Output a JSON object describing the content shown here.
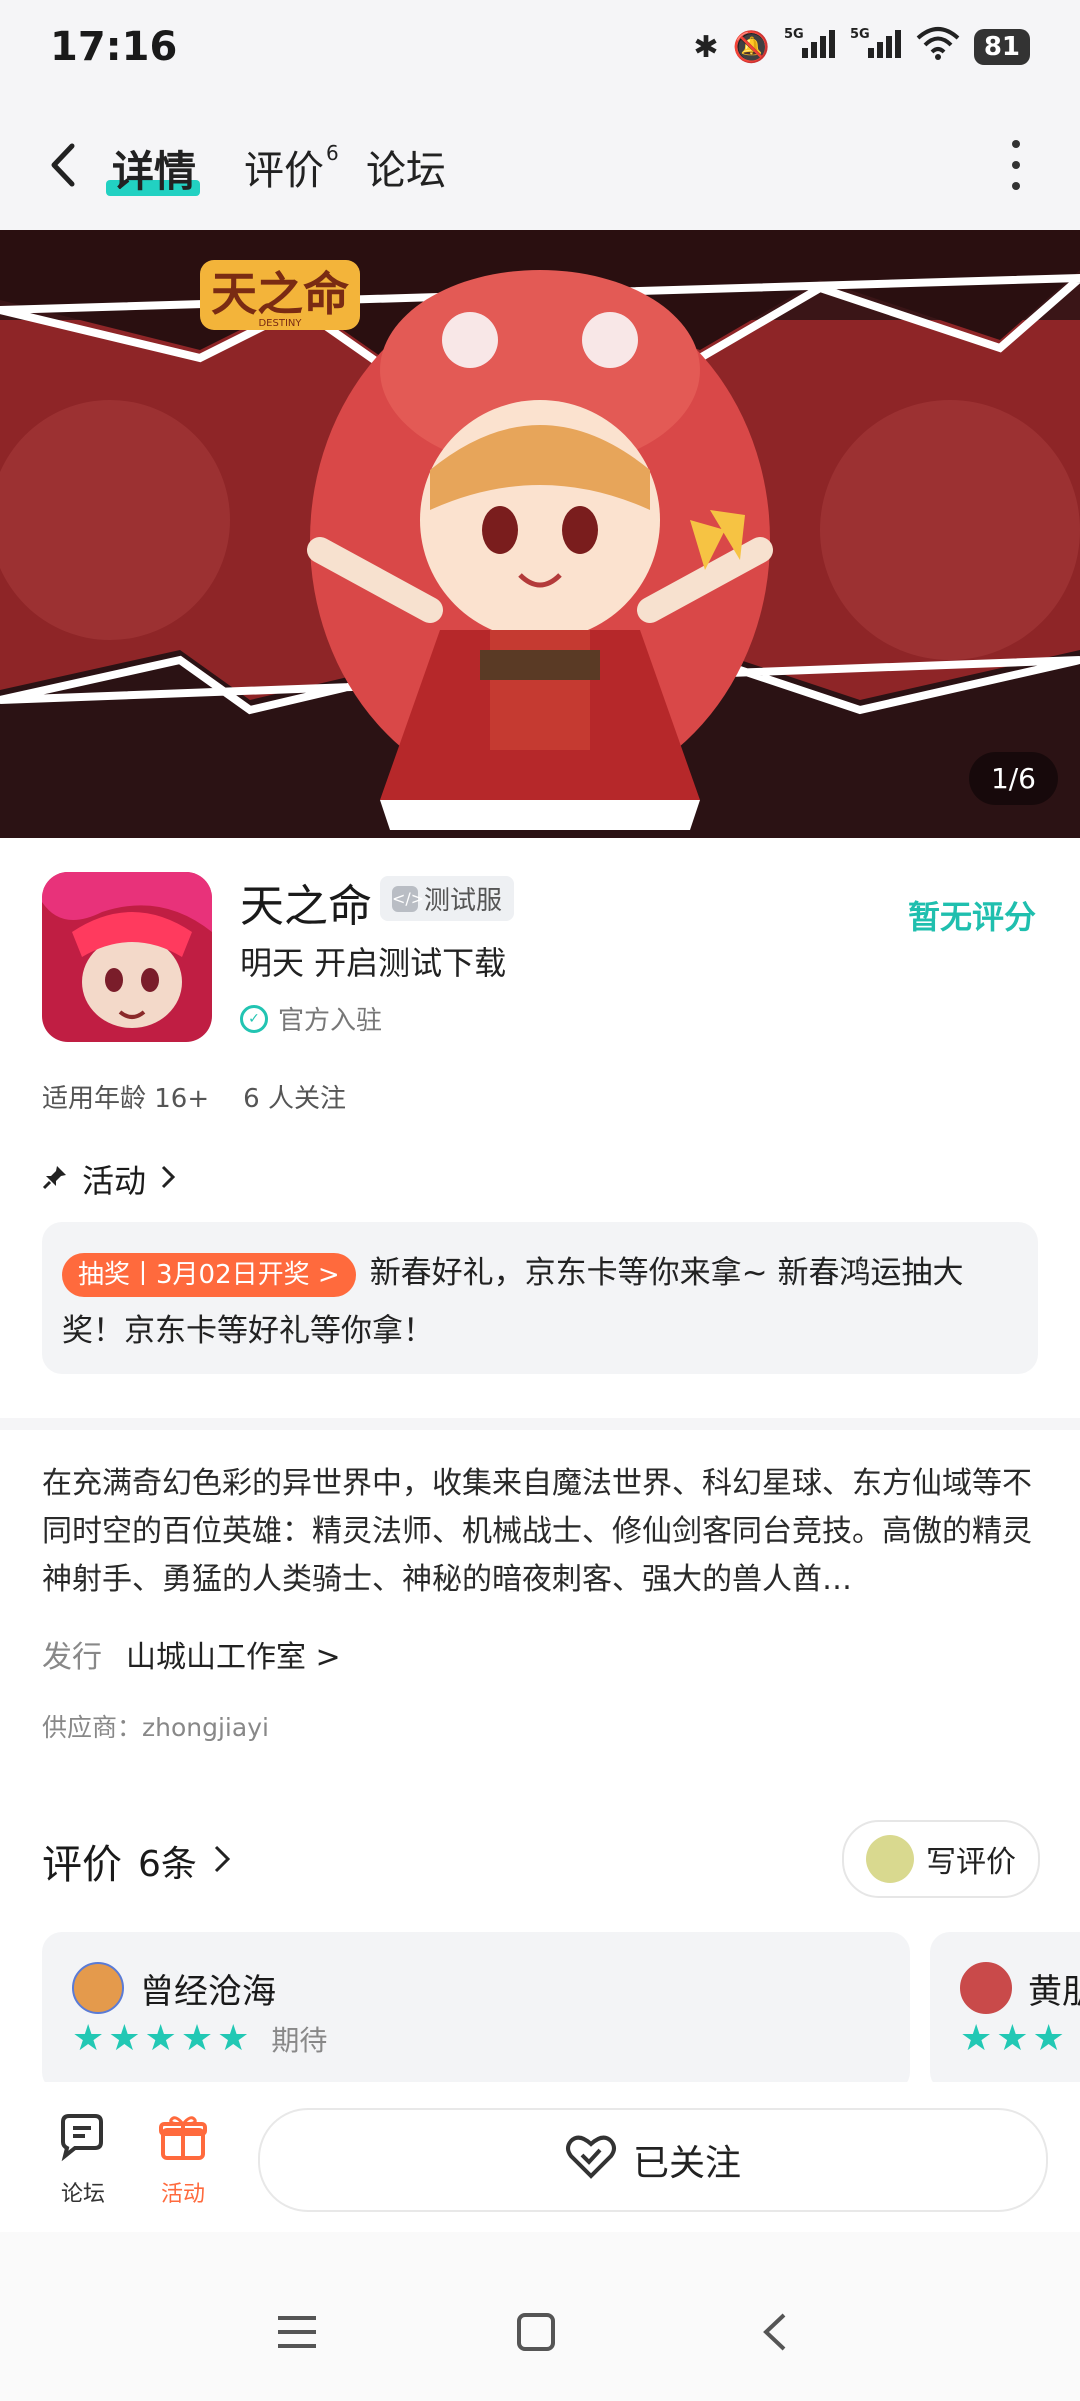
{
  "status_bar": {
    "time": "17:16",
    "battery": "81",
    "net1": "5G",
    "net2": "5G"
  },
  "nav": {
    "tabs": [
      {
        "label": "详情",
        "active": true
      },
      {
        "label": "评价",
        "sup": "6"
      },
      {
        "label": "论坛"
      }
    ]
  },
  "banner": {
    "counter": "1/6",
    "logo_text": "天之命",
    "logo_sub": "DESTINY"
  },
  "app": {
    "name": "天之命",
    "badge": "测试服",
    "rating": "暂无评分",
    "subtitle": "明天 开启测试下载",
    "official": "官方入驻",
    "age": "适用年龄 16+",
    "followers": "6 人关注"
  },
  "activity": {
    "title": "活动",
    "badge": "抽奖丨3月02日开奖 >",
    "text": "新春好礼，京东卡等你来拿~ 新春鸿运抽大奖！京东卡等好礼等你拿！"
  },
  "description": {
    "text": "在充满奇幻色彩的异世界中，收集来自魔法世界、科幻星球、东方仙域等不同时空的百位英雄：精灵法师、机械战士、修仙剑客同台竞技。高傲的精灵神射手、勇猛的人类骑士、神秘的暗夜刺客、强大的兽人酋…",
    "publisher_label": "发行",
    "publisher": "山城山工作室 >",
    "supplier": "供应商：zhongjiayi"
  },
  "reviews": {
    "title": "评价",
    "count": "6条",
    "write": "写评价",
    "items": [
      {
        "name": "曾经沧海",
        "stars": "★★★★★",
        "label": "期待"
      },
      {
        "name": "黄朋",
        "stars": "★★★"
      }
    ]
  },
  "bottom": {
    "forum": "论坛",
    "activity": "活动",
    "follow": "已关注"
  },
  "colors": {
    "accent": "#22d1c2",
    "orange": "#ff6a3d",
    "banner_red": "#8e2527"
  }
}
